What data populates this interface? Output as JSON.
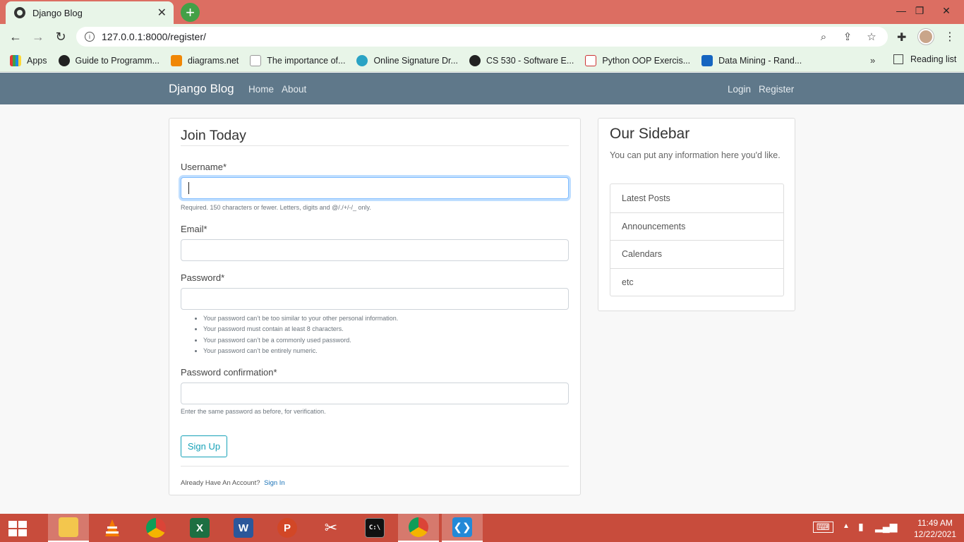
{
  "browser": {
    "tab_title": "Django Blog",
    "url": "127.0.0.1:8000/register/",
    "bookmarks": [
      "Apps",
      "Guide to Programm...",
      "diagrams.net",
      "The importance of...",
      "Online Signature Dr...",
      "CS 530 - Software E...",
      "Python OOP Exercis...",
      "Data Mining - Rand..."
    ],
    "more_bookmarks": "»",
    "reading_list": "Reading list"
  },
  "site": {
    "brand": "Django Blog",
    "nav_left": [
      "Home",
      "About"
    ],
    "nav_right": [
      "Login",
      "Register"
    ]
  },
  "form": {
    "legend": "Join Today",
    "username_label": "Username*",
    "username_help": "Required. 150 characters or fewer. Letters, digits and @/./+/-/_ only.",
    "email_label": "Email*",
    "password_label": "Password*",
    "password_help": [
      "Your password can’t be too similar to your other personal information.",
      "Your password must contain at least 8 characters.",
      "Your password can’t be a commonly used password.",
      "Your password can’t be entirely numeric."
    ],
    "password2_label": "Password confirmation*",
    "password2_help": "Enter the same password as before, for verification.",
    "submit_label": "Sign Up",
    "footer_text": "Already Have An Account?",
    "footer_link": "Sign In"
  },
  "sidebar": {
    "title": "Our Sidebar",
    "description": "You can put any information here you'd like.",
    "items": [
      "Latest Posts",
      "Announcements",
      "Calendars",
      "etc"
    ]
  },
  "taskbar": {
    "time": "11:49 AM",
    "date": "12/22/2021"
  },
  "colors": {
    "navbar": "#5f788a",
    "accent_button": "#17a2b8",
    "tabstrip": "#dc6e62",
    "taskbar": "#c84c3c"
  }
}
